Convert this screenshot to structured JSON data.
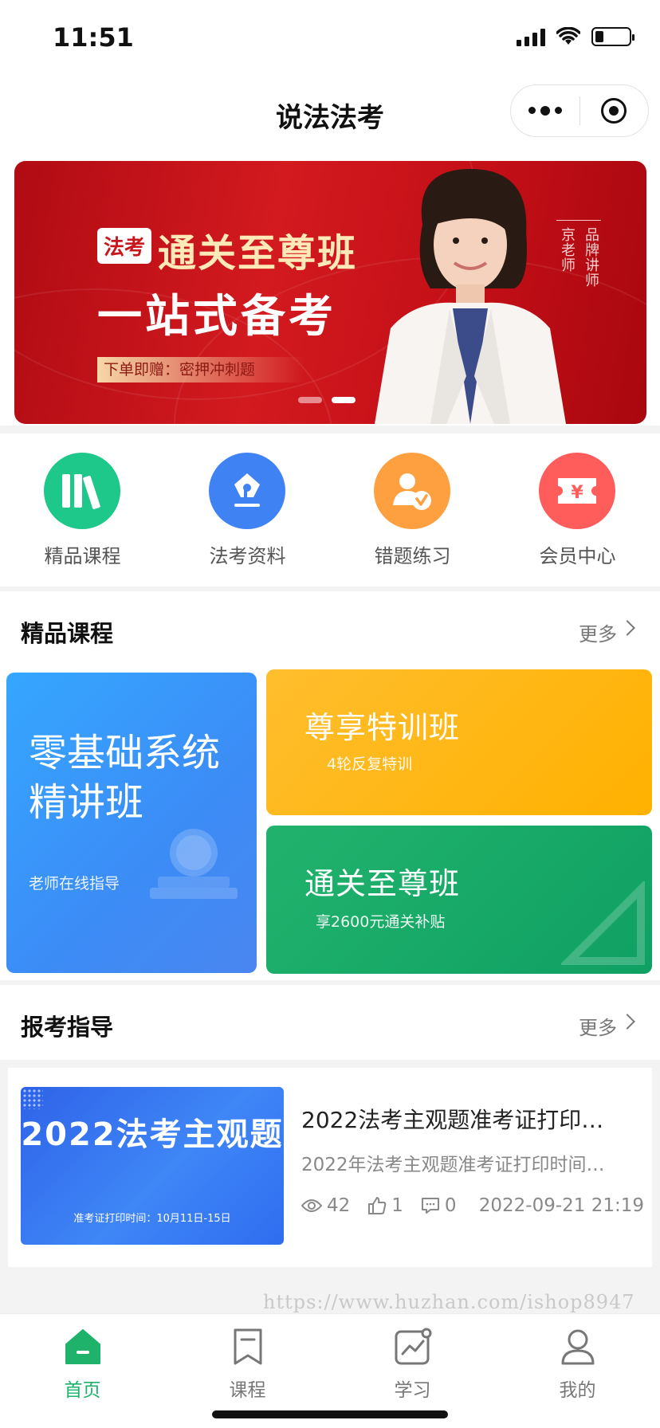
{
  "status_bar": {
    "time": "11:51"
  },
  "nav": {
    "title": "说法法考"
  },
  "banner": {
    "tag": "法考",
    "title": "通关至尊班",
    "subtitle": "一站式备考",
    "gift": "下单即赠：密押冲刺题",
    "side_text": [
      "品牌讲师",
      "京老师"
    ],
    "slides": 2,
    "active_slide": 1
  },
  "quick_menu": [
    {
      "label": "精品课程",
      "icon": "books-icon",
      "color": "#1ec78a"
    },
    {
      "label": "法考资料",
      "icon": "pen-nib-icon",
      "color": "#3f82f4"
    },
    {
      "label": "错题练习",
      "icon": "user-check-icon",
      "color": "#ffa040"
    },
    {
      "label": "会员中心",
      "icon": "yuan-ticket-icon",
      "color": "#ff5c5c"
    }
  ],
  "courses_section": {
    "title": "精品课程",
    "more": "更多",
    "items": [
      {
        "title": "零基础系统精讲班",
        "subtitle": "老师在线指导"
      },
      {
        "title": "尊享特训班",
        "subtitle": "4轮反复特训"
      },
      {
        "title": "通关至尊班",
        "subtitle": "享2600元通关补贴"
      }
    ]
  },
  "guide_section": {
    "title": "报考指导",
    "more": "更多",
    "article": {
      "thumb_title": "2022法考主观题",
      "thumb_subtitle": "准考证打印时间：10月11日-15日",
      "title": "2022法考主观题准考证打印…",
      "desc": "2022年法考主观题准考证打印时间…",
      "views": "42",
      "likes": "1",
      "comments": "0",
      "date": "2022-09-21 21:19"
    }
  },
  "watermark": "https://www.huzhan.com/ishop8947",
  "tab_bar": [
    {
      "label": "首页",
      "icon": "home-icon",
      "active": true
    },
    {
      "label": "课程",
      "icon": "bookmark-icon",
      "active": false
    },
    {
      "label": "学习",
      "icon": "chart-icon",
      "active": false
    },
    {
      "label": "我的",
      "icon": "user-icon",
      "active": false
    }
  ],
  "colors": {
    "accent": "#1fb26a",
    "banner_red": "#c8161d"
  }
}
